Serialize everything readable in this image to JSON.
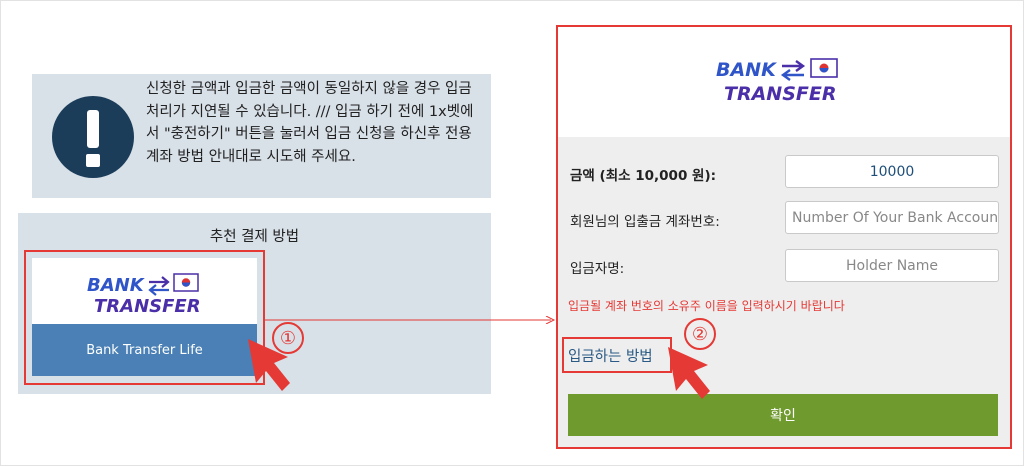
{
  "notice": {
    "text": "신청한 금액과 입금한 금액이 동일하지 않을 경우 입금처리가 지연될 수 있습니다. /// 입금 하기 전에 1x벳에서 \"충전하기\" 버튼을 눌러서 입금 신청을 하신후 전용 계좌 방법 안내대로 시도해 주세요."
  },
  "recommended": {
    "title": "추천 결제 방법",
    "method": {
      "logo_line1": "BANK",
      "logo_line2": "TRANSFER",
      "button_label": "Bank Transfer Life"
    }
  },
  "steps": {
    "one": "①",
    "two": "②"
  },
  "form": {
    "logo_line1": "BANK",
    "logo_line2": "TRANSFER",
    "amount_label": "금액 (최소 10,000 원):",
    "amount_value": "10000",
    "account_label": "회원님의 입출금 계좌번호:",
    "account_placeholder": "Number Of Your Bank Account",
    "holder_label": "입금자명:",
    "holder_placeholder": "Holder Name",
    "hint": "입금될 계좌 번호의 소유주 이름을 입력하시기 바랍니다",
    "howto_link": "입금하는 방법",
    "confirm_label": "확인"
  },
  "colors": {
    "accent_red": "#e53935",
    "panel_bg": "#d8e0e8",
    "brand_navy": "#1b3d5a",
    "logo_blue": "#2f55c9",
    "logo_purple": "#4a2fa8",
    "confirm_green": "#6f9a2e",
    "method_button_blue": "#4a80b5"
  },
  "icons": {
    "warning": "exclamation-icon",
    "swap": "swap-arrows-icon",
    "flag": "korea-flag-icon",
    "pointer": "cursor-pointer-icon"
  }
}
